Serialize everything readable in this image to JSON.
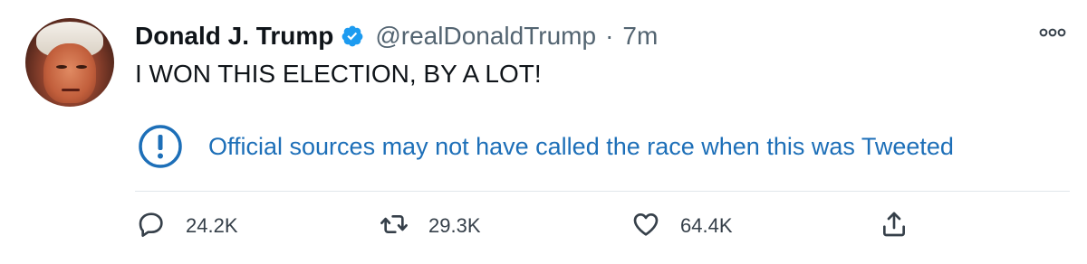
{
  "tweet": {
    "author": {
      "display_name": "Donald J. Trump",
      "handle": "@realDonaldTrump",
      "verified": true
    },
    "separator": "·",
    "timestamp": "7m",
    "text": "I WON THIS ELECTION, BY A LOT!",
    "notice": {
      "icon": "exclamation-circle-icon",
      "text": "Official sources may not have called the race when this was Tweeted"
    },
    "actions": {
      "reply_count": "24.2K",
      "retweet_count": "29.3K",
      "like_count": "64.4K"
    }
  },
  "colors": {
    "verified_blue": "#1d9bf0",
    "notice_blue": "#1d6fb8",
    "secondary_text": "#536471",
    "divider": "#e1e6ea"
  }
}
